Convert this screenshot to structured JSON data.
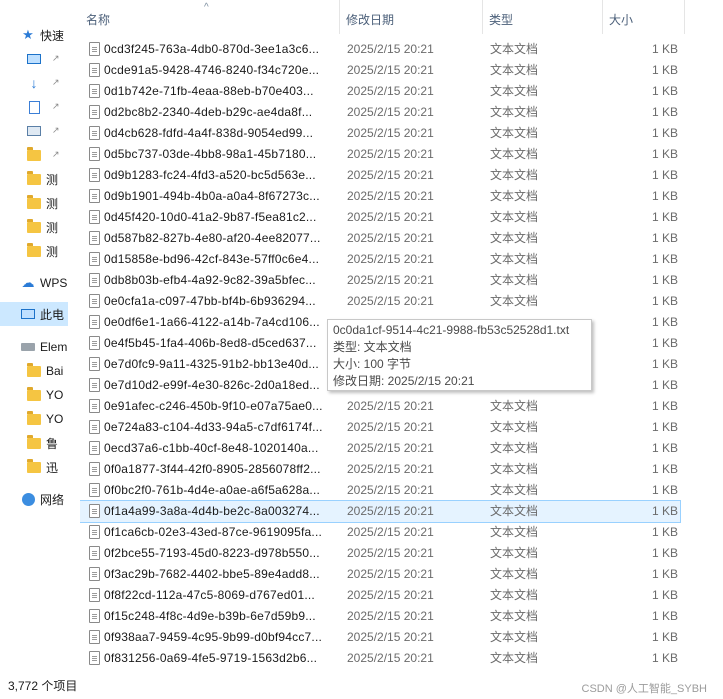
{
  "nav": {
    "items": [
      {
        "label": "快速",
        "icon": "star-icon",
        "pinned": false
      },
      {
        "label": "",
        "icon": "desktop-icon",
        "pinned": true
      },
      {
        "label": "",
        "icon": "download-icon",
        "pinned": true
      },
      {
        "label": "",
        "icon": "document-icon",
        "pinned": true
      },
      {
        "label": "",
        "icon": "picture-icon",
        "pinned": true
      },
      {
        "label": "",
        "icon": "folder-icon",
        "pinned": true
      },
      {
        "label": "测",
        "icon": "folder-icon",
        "pinned": false
      },
      {
        "label": "测",
        "icon": "folder-icon",
        "pinned": false
      },
      {
        "label": "测",
        "icon": "folder-icon",
        "pinned": false
      },
      {
        "label": "测",
        "icon": "folder-icon",
        "pinned": false
      },
      {
        "label": "WPS",
        "icon": "cloud-icon",
        "pinned": false
      },
      {
        "label": "此电",
        "icon": "computer-icon",
        "pinned": false
      },
      {
        "label": "Elem",
        "icon": "drive-icon",
        "pinned": false
      },
      {
        "label": "Bai",
        "icon": "folder-icon",
        "pinned": false
      },
      {
        "label": "YO",
        "icon": "folder-icon",
        "pinned": false
      },
      {
        "label": "YO",
        "icon": "folder-icon",
        "pinned": false
      },
      {
        "label": "鲁",
        "icon": "folder-icon",
        "pinned": false
      },
      {
        "label": "迅",
        "icon": "folder-icon",
        "pinned": false
      },
      {
        "label": "网络",
        "icon": "network-icon",
        "pinned": false
      }
    ]
  },
  "header": {
    "name": "名称",
    "date": "修改日期",
    "type": "类型",
    "size": "大小"
  },
  "rows": [
    {
      "name": "0cd3f245-763a-4db0-870d-3ee1a3c6...",
      "date": "2025/2/15 20:21",
      "type": "文本文档",
      "size": "1 KB"
    },
    {
      "name": "0cde91a5-9428-4746-8240-f34c720e...",
      "date": "2025/2/15 20:21",
      "type": "文本文档",
      "size": "1 KB"
    },
    {
      "name": "0d1b742e-71fb-4eaa-88eb-b70e403...",
      "date": "2025/2/15 20:21",
      "type": "文本文档",
      "size": "1 KB"
    },
    {
      "name": "0d2bc8b2-2340-4deb-b29c-ae4da8f...",
      "date": "2025/2/15 20:21",
      "type": "文本文档",
      "size": "1 KB"
    },
    {
      "name": "0d4cb628-fdfd-4a4f-838d-9054ed99...",
      "date": "2025/2/15 20:21",
      "type": "文本文档",
      "size": "1 KB"
    },
    {
      "name": "0d5bc737-03de-4bb8-98a1-45b7180...",
      "date": "2025/2/15 20:21",
      "type": "文本文档",
      "size": "1 KB"
    },
    {
      "name": "0d9b1283-fc24-4fd3-a520-bc5d563e...",
      "date": "2025/2/15 20:21",
      "type": "文本文档",
      "size": "1 KB"
    },
    {
      "name": "0d9b1901-494b-4b0a-a0a4-8f67273c...",
      "date": "2025/2/15 20:21",
      "type": "文本文档",
      "size": "1 KB"
    },
    {
      "name": "0d45f420-10d0-41a2-9b87-f5ea81c2...",
      "date": "2025/2/15 20:21",
      "type": "文本文档",
      "size": "1 KB"
    },
    {
      "name": "0d587b82-827b-4e80-af20-4ee82077...",
      "date": "2025/2/15 20:21",
      "type": "文本文档",
      "size": "1 KB"
    },
    {
      "name": "0d15858e-bd96-42cf-843e-57ff0c6e4...",
      "date": "2025/2/15 20:21",
      "type": "文本文档",
      "size": "1 KB"
    },
    {
      "name": "0db8b03b-efb4-4a92-9c82-39a5bfec...",
      "date": "2025/2/15 20:21",
      "type": "文本文档",
      "size": "1 KB"
    },
    {
      "name": "0e0cfa1a-c097-47bb-bf4b-6b936294...",
      "date": "2025/2/15 20:21",
      "type": "文本文档",
      "size": "1 KB"
    },
    {
      "name": "0e0df6e1-1a66-4122-a14b-7a4cd106...",
      "date": "",
      "type": "",
      "size": "1 KB"
    },
    {
      "name": "0e4f5b45-1fa4-406b-8ed8-d5ced637...",
      "date": "",
      "type": "",
      "size": "1 KB"
    },
    {
      "name": "0e7d0fc9-9a11-4325-91b2-bb13e40d...",
      "date": "",
      "type": "",
      "size": "1 KB"
    },
    {
      "name": "0e7d10d2-e99f-4e30-826c-2d0a18ed...",
      "date": "",
      "type": "",
      "size": "1 KB"
    },
    {
      "name": "0e91afec-c246-450b-9f10-e07a75ae0...",
      "date": "2025/2/15 20:21",
      "type": "文本文档",
      "size": "1 KB"
    },
    {
      "name": "0e724a83-c104-4d33-94a5-c7df6174f...",
      "date": "2025/2/15 20:21",
      "type": "文本文档",
      "size": "1 KB"
    },
    {
      "name": "0ecd37a6-c1bb-40cf-8e48-1020140a...",
      "date": "2025/2/15 20:21",
      "type": "文本文档",
      "size": "1 KB"
    },
    {
      "name": "0f0a1877-3f44-42f0-8905-2856078ff2...",
      "date": "2025/2/15 20:21",
      "type": "文本文档",
      "size": "1 KB"
    },
    {
      "name": "0f0bc2f0-761b-4d4e-a0ae-a6f5a628a...",
      "date": "2025/2/15 20:21",
      "type": "文本文档",
      "size": "1 KB"
    },
    {
      "name": "0f1a4a99-3a8a-4d4b-be2c-8a003274...",
      "date": "2025/2/15 20:21",
      "type": "文本文档",
      "size": "1 KB",
      "selected": true
    },
    {
      "name": "0f1ca6cb-02e3-43ed-87ce-9619095fa...",
      "date": "2025/2/15 20:21",
      "type": "文本文档",
      "size": "1 KB"
    },
    {
      "name": "0f2bce55-7193-45d0-8223-d978b550...",
      "date": "2025/2/15 20:21",
      "type": "文本文档",
      "size": "1 KB"
    },
    {
      "name": "0f3ac29b-7682-4402-bbe5-89e4add8...",
      "date": "2025/2/15 20:21",
      "type": "文本文档",
      "size": "1 KB"
    },
    {
      "name": "0f8f22cd-112a-47c5-8069-d767ed01...",
      "date": "2025/2/15 20:21",
      "type": "文本文档",
      "size": "1 KB"
    },
    {
      "name": "0f15c248-4f8c-4d9e-b39b-6e7d59b9...",
      "date": "2025/2/15 20:21",
      "type": "文本文档",
      "size": "1 KB"
    },
    {
      "name": "0f938aa7-9459-4c95-9b99-d0bf94cc7...",
      "date": "2025/2/15 20:21",
      "type": "文本文档",
      "size": "1 KB"
    },
    {
      "name": "0f831256-0a69-4fe5-9719-1563d2b6...",
      "date": "2025/2/15 20:21",
      "type": "文本文档",
      "size": "1 KB"
    }
  ],
  "tooltip": {
    "filename": "0c0da1cf-9514-4c21-9988-fb53c52528d1.txt",
    "type_line": "类型: 文本文档",
    "size_line": "大小: 100 字节",
    "date_line": "修改日期: 2025/2/15 20:21"
  },
  "status": {
    "count": "3,772 个项目"
  },
  "watermark": "CSDN @人工智能_SYBH"
}
